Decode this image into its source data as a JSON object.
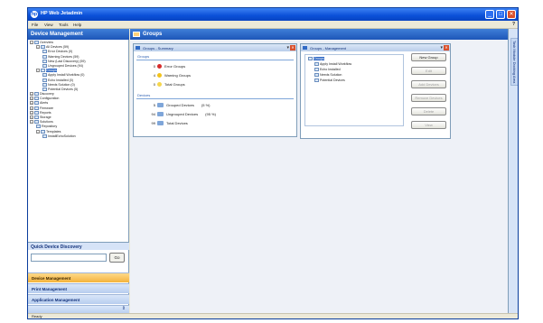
{
  "window": {
    "title": "HP Web Jetadmin",
    "minimize": "_",
    "maximize": "□",
    "close": "✕"
  },
  "menu": [
    "File",
    "View",
    "Tools",
    "Help"
  ],
  "help_icon": "?",
  "left_pane": {
    "header": "Device Management",
    "tree": [
      {
        "label": "Overview",
        "indent": 0,
        "exp": "−"
      },
      {
        "label": "All Devices (59)",
        "indent": 1,
        "exp": "−"
      },
      {
        "label": "Error Devices (0)",
        "indent": 2
      },
      {
        "label": "Warning Devices (59)",
        "indent": 2
      },
      {
        "label": "New (Last Discovery) (59)",
        "indent": 2
      },
      {
        "label": "Ungrouped Devices (94)",
        "indent": 2
      },
      {
        "label": "Groups",
        "indent": 1,
        "exp": "−",
        "selected": true
      },
      {
        "label": "Apply Install Workflow (0)",
        "indent": 2
      },
      {
        "label": "Echo Installed (0)",
        "indent": 2
      },
      {
        "label": "Needs Solution (0)",
        "indent": 2
      },
      {
        "label": "Potential Devices (5)",
        "indent": 2
      },
      {
        "label": "Discovery",
        "indent": 0,
        "exp": "+"
      },
      {
        "label": "Configuration",
        "indent": 0,
        "exp": "+"
      },
      {
        "label": "Alerts",
        "indent": 0,
        "exp": "+"
      },
      {
        "label": "Firmware",
        "indent": 0,
        "exp": "+"
      },
      {
        "label": "Reports",
        "indent": 0,
        "exp": "+"
      },
      {
        "label": "Storage",
        "indent": 0,
        "exp": "+"
      },
      {
        "label": "Solutions",
        "indent": 0,
        "exp": "−"
      },
      {
        "label": "Repository",
        "indent": 1
      },
      {
        "label": "Templates",
        "indent": 1,
        "exp": "−"
      },
      {
        "label": "InstallEchoSolution",
        "indent": 2
      }
    ],
    "quick_discovery": {
      "header": "Quick Device Discovery",
      "input_value": "",
      "go_label": "Go"
    },
    "nav": [
      {
        "label": "Device Management",
        "active": true
      },
      {
        "label": "Print Management",
        "active": false
      },
      {
        "label": "Application Management",
        "active": false
      }
    ],
    "nav_more": "⇕"
  },
  "main": {
    "header": "Groups",
    "summary_panel": {
      "title": "Groups - Summary",
      "groups_heading": "Groups",
      "group_rows": [
        {
          "count": "0",
          "label": "Error Groups",
          "color": "#d62b2b"
        },
        {
          "count": "4",
          "label": "Warning Groups",
          "color": "#f2c21b"
        },
        {
          "count": "0",
          "label": "Total Groups",
          "color": "#f6d64c"
        }
      ],
      "devices_heading": "Devices",
      "device_rows": [
        {
          "count": "5",
          "label": "Grouped Devices",
          "pct": "(5 %)"
        },
        {
          "count": "94",
          "label": "Ungrouped Devices",
          "pct": "(95 %)"
        },
        {
          "count": "99",
          "label": "Total Devices",
          "pct": ""
        }
      ]
    },
    "mgmt_panel": {
      "title": "Groups - Management",
      "tree": [
        {
          "label": "Groups",
          "indent": 0,
          "selected": true
        },
        {
          "label": "Apply Install Workflow",
          "indent": 1
        },
        {
          "label": "Echo Installed",
          "indent": 1
        },
        {
          "label": "Needs Solution",
          "indent": 1
        },
        {
          "label": "Potential Devices",
          "indent": 1
        }
      ],
      "buttons": [
        {
          "label": "New Group",
          "disabled": false
        },
        {
          "label": "Edit",
          "disabled": true
        },
        {
          "label": "Add Devices",
          "disabled": true
        },
        {
          "label": "Remove Devices",
          "disabled": true
        },
        {
          "label": "Delete",
          "disabled": true
        },
        {
          "label": "View",
          "disabled": true
        }
      ]
    }
  },
  "side_tab": "Task Module Docking Area",
  "status": "Ready",
  "colors": {
    "title_bar": "#0a50d8",
    "pane_header": "#1d56b8",
    "active_nav": "#f4b33b",
    "selection": "#316ac5"
  }
}
